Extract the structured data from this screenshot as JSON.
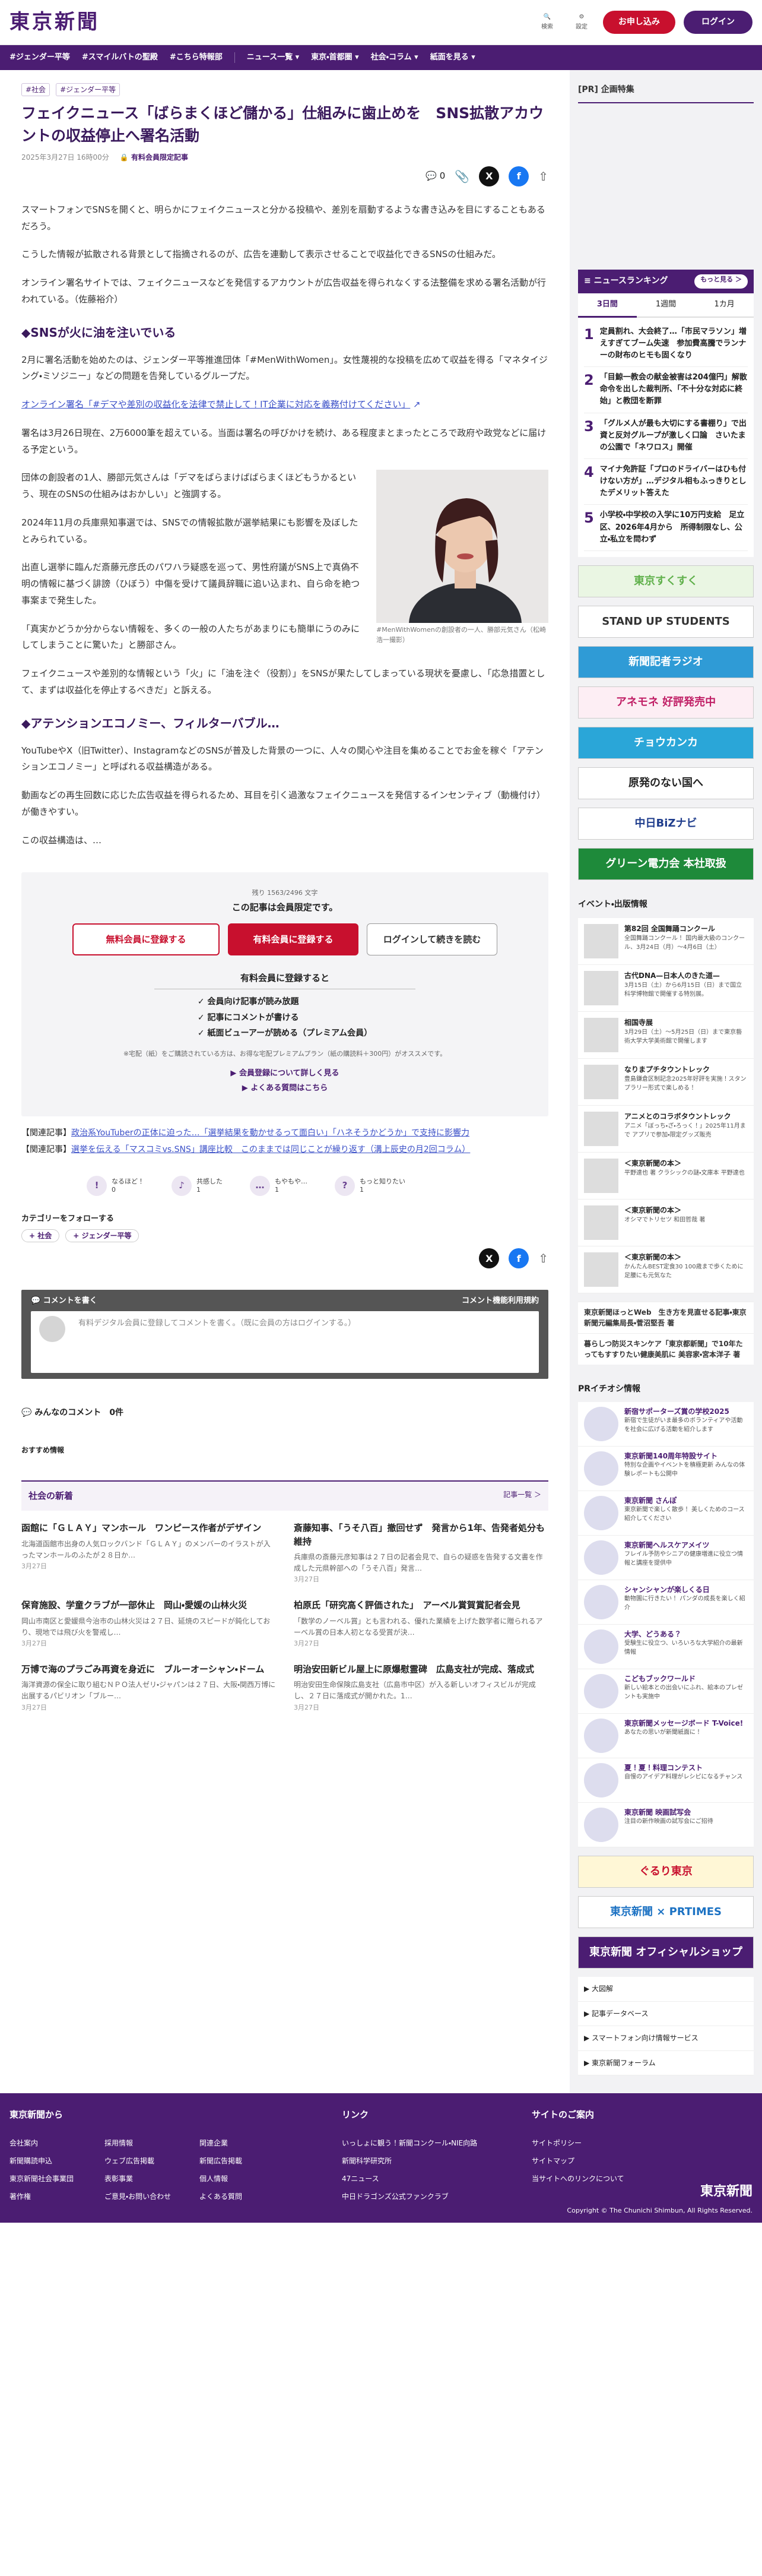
{
  "header": {
    "logo": "東京新聞",
    "search": "検索",
    "settings": "設定",
    "register": "お申し込み",
    "login": "ログイン"
  },
  "gnav": [
    "#ジェンダー平等",
    "#スマイルバトの聖殿",
    "#こちら特報部",
    "ニュース一覧 ▾",
    "東京・首都圏 ▾",
    "社会・コラム ▾",
    "紙面を見る ▾"
  ],
  "article": {
    "crumbs": [
      "#社会",
      "#ジェンダー平等"
    ],
    "title": "フェイクニュース「ばらまくほど儲かる」仕組みに歯止めを　SNS拡散アカウントの収益停止へ署名活動",
    "date": "2025年3月27日 16時00分",
    "paid": "有料会員限定記事",
    "comments": "0",
    "p1": "スマートフォンでSNSを開くと、明らかにフェイクニュースと分かる投稿や、差別を扇動するような書き込みを目にすることもあるだろう。",
    "p2": "こうした情報が拡散される背景として指摘されるのが、広告を連動して表示させることで収益化できるSNSの仕組みだ。",
    "p3": "オンライン署名サイトでは、フェイクニュースなどを発信するアカウントが広告収益を得られなくする法整備を求める署名活動が行われている。（佐藤裕介）",
    "h2a": "◆SNSが火に油を注いでいる",
    "p4": "2月に署名活動を始めたのは、ジェンダー平等推進団体「#MenWithWomen」。女性蔑視的な投稿を広めて収益を得る「マネタイジング・ミソジニー」などの問題を告発しているグループだ。",
    "link": "オンライン署名「#デマや差別の収益化を法律で禁止して！IT企業に対応を義務付けてください」",
    "p5": "署名は3月26日現在、2万6000筆を超えている。当面は署名の呼びかけを続け、ある程度まとまったところで政府や政党などに届ける予定という。",
    "p6": "団体の創設者の1人、勝部元気さんは「デマをばらまけばばらまくほどもうかるという、現在のSNSの仕組みはおかしい」と強調する。",
    "p7": "2024年11月の兵庫県知事選では、SNSでの情報拡散が選挙結果にも影響を及ぼしたとみられている。",
    "p8": "出直し選挙に臨んだ斎藤元彦氏のパワハラ疑惑を巡って、男性府議がSNS上で真偽不明の情報に基づく誹謗（ひぼう）中傷を受けて議員辞職に追い込まれ、自ら命を絶つ事案まで発生した。",
    "p9": "「真実かどうか分からない情報を、多くの一般の人たちがあまりにも簡単にうのみにしてしまうことに驚いた」と勝部さん。",
    "p10": "フェイクニュースや差別的な情報という「火」に「油を注ぐ（役割）」をSNSが果たしてしまっている現状を憂慮し、「応急措置として、まずは収益化を停止するべきだ」と訴える。",
    "h2b": "◆アテンションエコノミー、フィルターバブル…",
    "p11": "YouTubeやX（旧Twitter）、InstagramなどのSNSが普及した背景の一つに、人々の関心や注目を集めることでお金を稼ぐ「アテンションエコノミー」と呼ばれる収益構造がある。",
    "p12": "動画などの再生回数に応じた広告収益を得られるため、耳目を引く過激なフェイクニュースを発信するインセンティブ（動機付け）が働きやすい。",
    "p13": "この収益構造は、…",
    "caption": "#MenWithWomenの創設者の一人、勝部元気さん（松崎浩一撮影）"
  },
  "paywall": {
    "remaining": "残り 1563/2496 文字",
    "title": "この記事は会員限定です。",
    "b1": "無料会員に登録する",
    "b2": "有料会員に登録する",
    "b3": "ログインして続きを読む",
    "sub": "有料会員に登録すると",
    "list": [
      "✓ 会員向け記事が読み放題",
      "✓ 記事にコメントが書ける",
      "✓ 紙面ビューアーが読める（プレミアム会員）"
    ],
    "note": "※宅配（紙）をご購読されている方は、お得な宅配プレミアムプラン（紙の購読料＋300円）がオススメです。",
    "l1": "▶ 会員登録について詳しく見る",
    "l2": "▶ よくある質問はこちら"
  },
  "related": [
    {
      "label": "【関連記事】",
      "text": "政治系YouTuberの正体に迫った…「選挙結果を動かせるって面白い」「ハネそうかどうか」で支持に影響力"
    },
    {
      "label": "【関連記事】",
      "text": "選挙を伝える「マスコミvs.SNS」講座比較　このままでは同じことが繰り返す（溝上辰史の月2回コラム）"
    }
  ],
  "reactions": [
    {
      "icon": "!",
      "label": "なるほど！",
      "n": "0"
    },
    {
      "icon": "♪",
      "label": "共感した",
      "n": "1"
    },
    {
      "icon": "…",
      "label": "もやもや…",
      "n": "1"
    },
    {
      "icon": "?",
      "label": "もっと知りたい",
      "n": "1"
    }
  ],
  "follow": {
    "label": "カテゴリーをフォローする",
    "tags": [
      "+ 社会",
      "+ ジェンダー平等"
    ]
  },
  "comment": {
    "title": "コメントを書く",
    "rule": "コメント機能利用規約",
    "box": "有料デジタル会員に登録してコメントを書く。（既に会員の方はログインする。）",
    "all": "みんなのコメント",
    "count": "0件"
  },
  "recommend": "おすすめ情報",
  "news": {
    "title": "社会の新着",
    "more": "記事一覧 ＞",
    "items": [
      {
        "t": "函館に「ＧＬＡＹ」マンホール　ワンピース作者がデザイン",
        "s": "北海道函館市出身の人気ロックバンド「ＧＬＡＹ」のメンバーのイラストが入ったマンホールのふたが２８日か…",
        "d": "3月27日"
      },
      {
        "t": "斎藤知事、「うそ八百」撤回せず　発言から1年、告発者処分も維持",
        "s": "兵庫県の斎藤元彦知事は２７日の記者会見で、自らの疑惑を告発する文書を作成した元県幹部への「うそ八百」発言…",
        "d": "3月27日"
      },
      {
        "t": "保育施設、学童クラブが一部休止　岡山・愛媛の山林火災",
        "s": "岡山市南区と愛媛県今治市の山林火災は２７日、延焼のスピードが鈍化しており、現地では飛び火を警戒し…",
        "d": "3月27日"
      },
      {
        "t": "柏原氏「研究高く評価された」　アーベル賞賀賞記者会見",
        "s": "「数学のノーベル賞」とも言われる、優れた業績を上げた数学者に贈られるアーベル賞の日本人初となる受賞が決…",
        "d": "3月27日"
      },
      {
        "t": "万博で海のプラごみ再資を身近に　ブルーオーシャン・ドーム",
        "s": "海洋資源の保全に取り組むＮＰＯ法人ゼリ・ジャパンは２７日、大阪・関西万博に出展するパビリオン「ブルー…",
        "d": "3月27日"
      },
      {
        "t": "明治安田新ビル屋上に原爆慰霊碑　広島支社が完成、落成式",
        "s": "明治安田生命保険広島支社（広島市中区）が入る新しいオフィスビルが完成し、２７日に落成式が開かれた。1…",
        "d": "3月27日"
      }
    ]
  },
  "side": {
    "pr": "[PR] 企画特集",
    "rank_title": "≡ ニュースランキング",
    "rank_more": "もっと見る ＞",
    "tabs": [
      "3日間",
      "1週間",
      "1カ月"
    ],
    "ranks": [
      {
        "n": "1",
        "t": "定員割れ、大会終了…「市民マラソン」増えすぎてブーム失速　参加費高騰でランナーの財布のヒモも固くなり"
      },
      {
        "n": "2",
        "t": "「目鯨一教会の献金被害は204億円」解散命令を出した裁判所、「不十分な対応に終始」と教団を断罪"
      },
      {
        "n": "3",
        "t": "「グルメ人が最も大切にする書棚り」で出資と反対グループが激しく口論　さいたまの公園で「ネワロス」開催"
      },
      {
        "n": "4",
        "t": "マイナ免許証「プロのドライバーはひも付けない方が」…デジタル相もふっきりとしたデメリット答えた"
      },
      {
        "n": "5",
        "t": "小学校・中学校の入学に10万円支給　足立区、2026年4月から　所得制限なし、公立・私立を問わず"
      }
    ],
    "banners": [
      {
        "t": "東京すくすく",
        "c": "#5fb04a",
        "bg": "#eaf6e3"
      },
      {
        "t": "STAND UP STUDENTS",
        "c": "#333",
        "bg": "#fff"
      },
      {
        "t": "新聞記者ラジオ",
        "c": "#fff",
        "bg": "#2f9bd6"
      },
      {
        "t": "アネモネ 好評発売中",
        "c": "#c01e65",
        "bg": "#fdeef4"
      },
      {
        "t": "チョウカンカ",
        "c": "#fff",
        "bg": "#2aa6d8"
      },
      {
        "t": "原発のない国へ",
        "c": "#222",
        "bg": "#fff"
      },
      {
        "t": "中日BiZナビ",
        "c": "#1e3c8c",
        "bg": "#fff"
      },
      {
        "t": "グリーン電力会 本社取扱",
        "c": "#fff",
        "bg": "#1e8a3a"
      }
    ],
    "ev_title": "イベント・出版情報",
    "events": [
      {
        "t": "第82回 全国舞踊コンクール",
        "s": "全国舞踊コンクール！ 国内最大級のコンクール、3月24日（月）〜4月6日（土）"
      },
      {
        "t": "古代DNA—日本人のきた道—",
        "s": "3月15日（土）から6月15日（日）まで国立科学博物館で開催する特別展。"
      },
      {
        "t": "相国寺展",
        "s": "3月29日（土）〜5月25日（日）まで東京藝術大学大学美術館で開催します"
      },
      {
        "t": "なりまプチタウントレック",
        "s": "豊島鎌倉区制記念2025年好評を実施！スタンプラリー形式で楽しめる！"
      },
      {
        "t": "アニメとのコラボタウントレック",
        "s": "アニメ「ぼっち・ざ・ろっく！」2025年11月まで アプリで参加・限定グッズ販売"
      },
      {
        "t": "＜東京新聞の本＞",
        "s": "平野達也 著 クラシックの謎・文庫本 平野達也"
      },
      {
        "t": "＜東京新聞の本＞",
        "s": "オシマでトリセツ 和田哲哉 著"
      },
      {
        "t": "＜東京新聞の本＞",
        "s": "かんたんBEST定食30 100歳まで歩くために 足腰にも元気なた"
      }
    ],
    "links": [
      "東京新聞ほっとWeb　生き方を見直せる記事・東京新聞元編集局長・菅沼堅吾 著",
      "暮らしつ防災スキンケア「東京都新聞」で10年たってもすすりたい健康美肌に 美容家・宮本洋子 著"
    ],
    "pr_title": "PRイチオシ情報",
    "prs": [
      {
        "t": "新宿サポーターズ賞の学校2025",
        "s": "新宿で生徒がいま最多のボランティアや活動を社会に広げる活動を紹介します"
      },
      {
        "t": "東京新聞140周年特設サイト",
        "s": "特別な企画やイベントを積極更新 みんなの体験レポートも公開中"
      },
      {
        "t": "東京新聞 さんぽ",
        "s": "東京新聞で楽しく散歩！ 美しくためのコース紹介してください"
      },
      {
        "t": "東京新聞ヘルスケアメイツ",
        "s": "フレイル予防やシニアの健康増進に役立つ情報と講座を提供中"
      },
      {
        "t": "シャンシャンが楽しくる日",
        "s": "動物園に行きたい！ パンダの成長を楽しく紹介"
      },
      {
        "t": "大学、どうある？",
        "s": "受験生に役立つ、いろいろな大学紹介の最新情報"
      },
      {
        "t": "こどもブックワールド",
        "s": "新しい絵本との出会いにふれ、絵本のプレゼントも実施中"
      },
      {
        "t": "東京新聞メッセージボード T-Voice!",
        "s": "あなたの思いが新聞紙面に！"
      },
      {
        "t": "夏！夏！料理コンテスト",
        "s": "自慢のアイデア料理がレシピになるチャンス"
      },
      {
        "t": "東京新聞 映画試写会",
        "s": "注目の新作映画の試写会にご招待"
      }
    ],
    "foot_banners": [
      {
        "t": "ぐるり東京",
        "c": "#c8102e",
        "bg": "#fff7d6"
      },
      {
        "t": "東京新聞 × PRTIMES",
        "c": "#1c72c3",
        "bg": "#fff"
      },
      {
        "t": "東京新聞 オフィシャルショップ",
        "c": "#fff",
        "bg": "#4b1d72"
      }
    ],
    "foot_links": [
      "▶ 大図解",
      "▶ 記事データベース",
      "▶ スマートフォン向け情報サービス",
      "▶ 東京新聞フォーラム"
    ]
  },
  "footer": {
    "c1": {
      "title": "東京新聞から",
      "items": [
        "会社案内",
        "採用情報",
        "関連企業",
        "新聞購読申込",
        "ウェブ広告掲載",
        "新聞広告掲載",
        "東京新聞社会事業団",
        "表彰事業",
        "個人情報",
        "著作権",
        "ご意見・お問い合わせ",
        "よくある質問"
      ]
    },
    "c2": {
      "title": "リンク",
      "items": [
        "いっしょに観う！新聞コンクール・NIE向路",
        "新聞科学研究所",
        "47ニュース",
        "中日ドラゴンズ公式ファンクラブ"
      ]
    },
    "c3": {
      "title": "サイトのご案内",
      "items": [
        "サイトポリシー",
        "サイトマップ",
        "当サイトへのリンクについて"
      ]
    },
    "logo": "東京新聞",
    "copy": "Copyright © The Chunichi Shimbun, All Rights Reserved."
  }
}
